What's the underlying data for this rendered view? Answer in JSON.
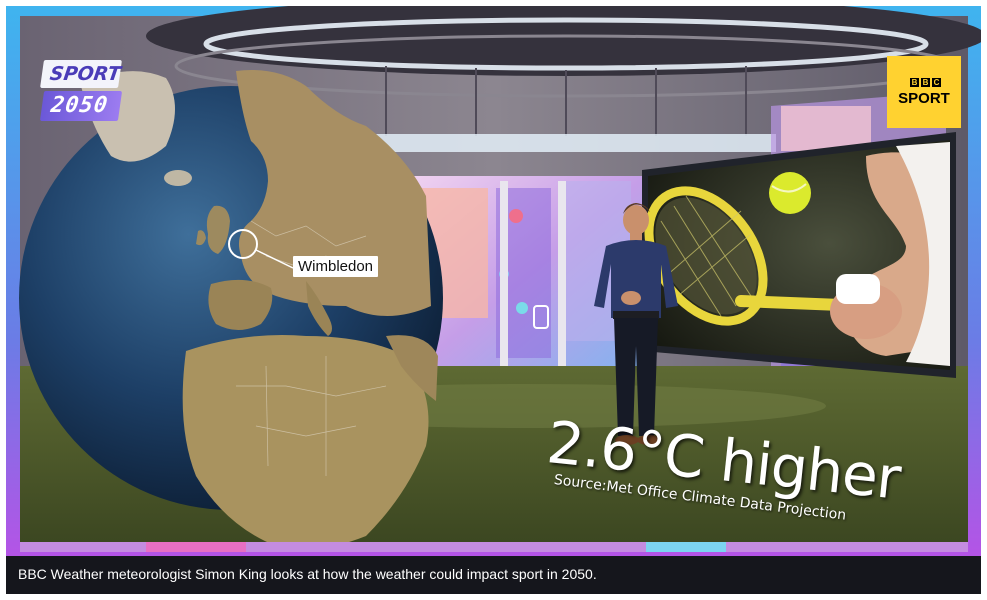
{
  "caption": "BBC Weather meteorologist Simon King looks at how the weather could impact sport in 2050.",
  "badge": {
    "line1": "SPORT",
    "line2": "2050"
  },
  "bbc_logo": {
    "blocks": [
      "B",
      "B",
      "C"
    ],
    "text": "SPORT"
  },
  "map_label": "Wimbledon",
  "temperature_text": "2.6°C higher",
  "source_text": "Source:Met Office Climate Data Projection",
  "colors": {
    "caption_bg": "#15161c",
    "accent_yellow": "#ffd230",
    "badge_purple": "#6b58d8",
    "border_blue": "#3fb4ef",
    "border_purple": "#b454e6",
    "floor_green": "#4b5a2a"
  }
}
